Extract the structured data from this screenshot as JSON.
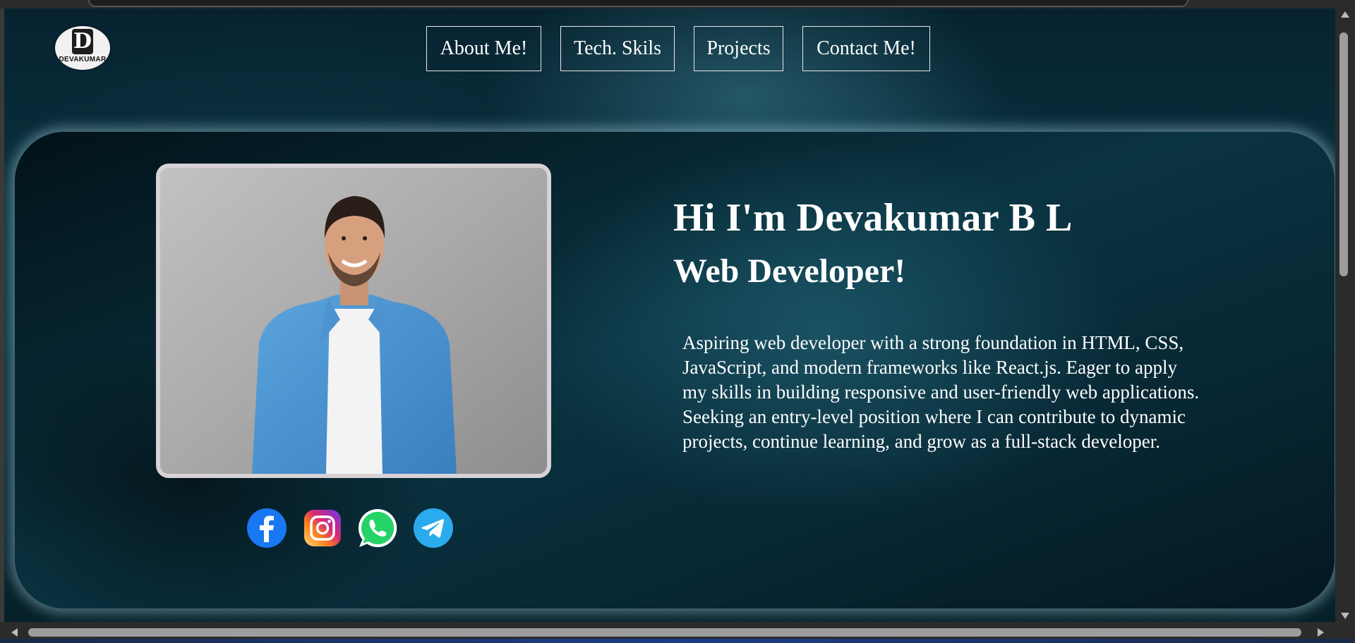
{
  "logo": {
    "letter": "D",
    "text": "DEVAKUMAR",
    "icon": "d-monogram-logo-icon"
  },
  "nav": {
    "items": [
      {
        "label": "About Me!"
      },
      {
        "label": "Tech. Skils"
      },
      {
        "label": "Projects"
      },
      {
        "label": "Contact Me!"
      }
    ]
  },
  "hero": {
    "name": "Hi I'm Devakumar B L",
    "role": "Web Developer!",
    "bio": "Aspiring web developer with a strong foundation in HTML, CSS, JavaScript, and modern frameworks like React.js. Eager to apply my skills in building responsive and user-friendly web applications. Seeking an entry-level position where I can contribute to dynamic projects, continue learning, and grow as a full-stack developer.",
    "photo_icon": "profile-photo-man-denim-shirt"
  },
  "socials": [
    {
      "name": "facebook",
      "icon": "facebook-icon",
      "color": "#1877F2"
    },
    {
      "name": "instagram",
      "icon": "instagram-icon",
      "color": "#E1306C"
    },
    {
      "name": "whatsapp",
      "icon": "whatsapp-icon",
      "color": "#25D366"
    },
    {
      "name": "telegram",
      "icon": "telegram-icon",
      "color": "#2AABEE"
    }
  ],
  "colors": {
    "background": "#0a3442",
    "hero_glow": "#b4dce6",
    "nav_border": "#e8e8e8",
    "text": "#ffffff"
  }
}
